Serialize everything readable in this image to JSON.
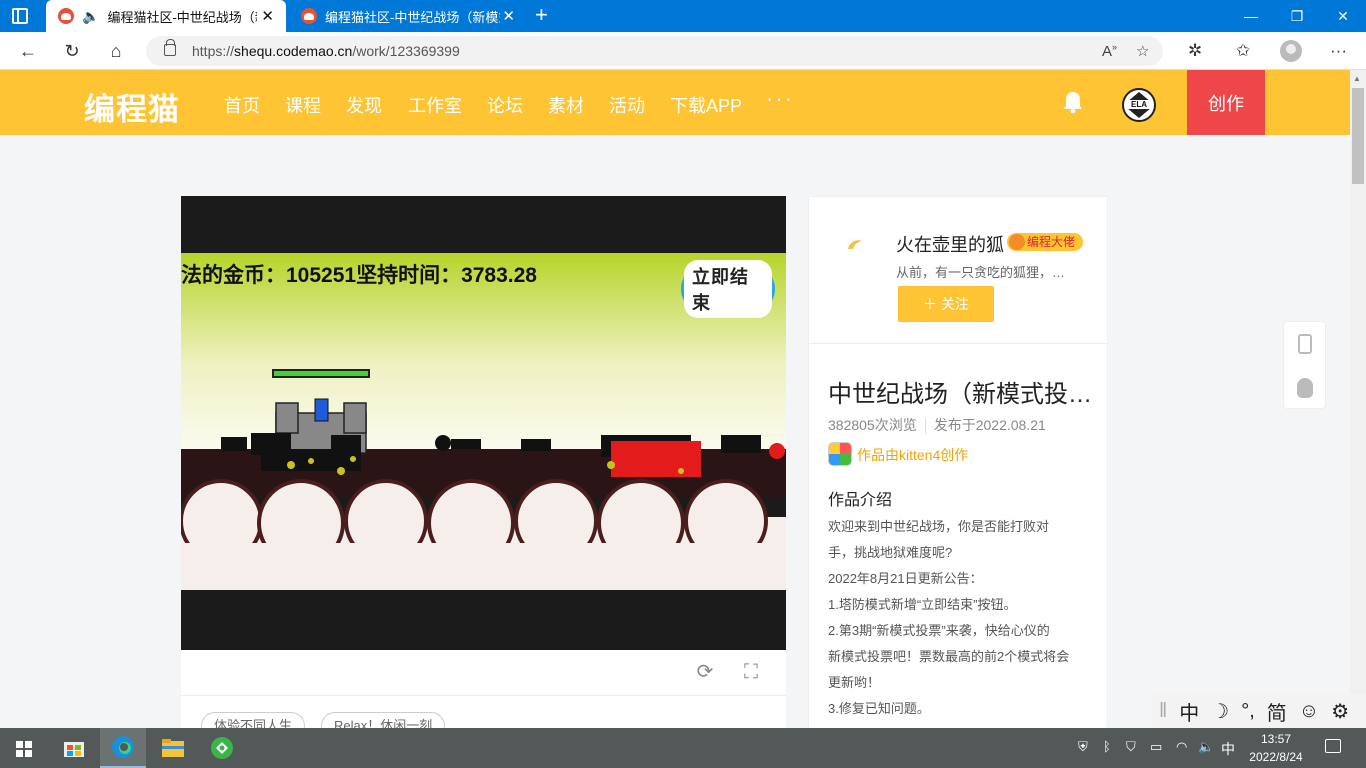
{
  "browser": {
    "tabs": [
      {
        "title": "编程猫社区-中世纪战场（新",
        "audio": true,
        "active": true
      },
      {
        "title": "编程猫社区-中世纪战场（新模式",
        "audio": false,
        "active": false
      }
    ],
    "url_prefix": "https://",
    "url_host": "shequ.codemao.cn",
    "url_path": "/work/123369399"
  },
  "site": {
    "logo": "编程猫",
    "nav": [
      "首页",
      "课程",
      "发现",
      "工作室",
      "论坛",
      "素材",
      "活动",
      "下载APP"
    ],
    "more": "···",
    "avatar_label": "ELA",
    "create_label": "创作",
    "brand_color": "#fec433",
    "create_color": "#ef4749"
  },
  "game": {
    "hud": "法的金币：105251坚持时间：3783.28",
    "end_button": "立即结束"
  },
  "tags": [
    "体验不同人生",
    "Relax！休闲一刻"
  ],
  "author": {
    "name": "火在壶里的狐",
    "badge": "编程大佬",
    "bio": "从前，有一只贪吃的狐狸，…",
    "follow": "＋ 关注"
  },
  "work": {
    "title": "中世纪战场（新模式投…",
    "views": "382805次浏览",
    "published": "发布于2022.08.21",
    "made_with": "作品由kitten4创作",
    "intro_heading": "作品介绍",
    "intro_lines": [
      "欢迎来到中世纪战场，你是否能打败对",
      "手，挑战地狱难度呢?",
      "2022年8月21日更新公告：",
      "1.塔防模式新增“立即结束”按钮。",
      "2.第3期“新模式投票”来袭，快给心仪的",
      "新模式投票吧！票数最高的前2个模式将会",
      "更新哟！",
      "3.修复已知问题。"
    ]
  },
  "ime": [
    "中",
    "☽",
    "°,",
    "简",
    "☺",
    "⚙"
  ],
  "taskbar": {
    "time": "13:57",
    "date": "2022/8/24",
    "lang": "中"
  }
}
